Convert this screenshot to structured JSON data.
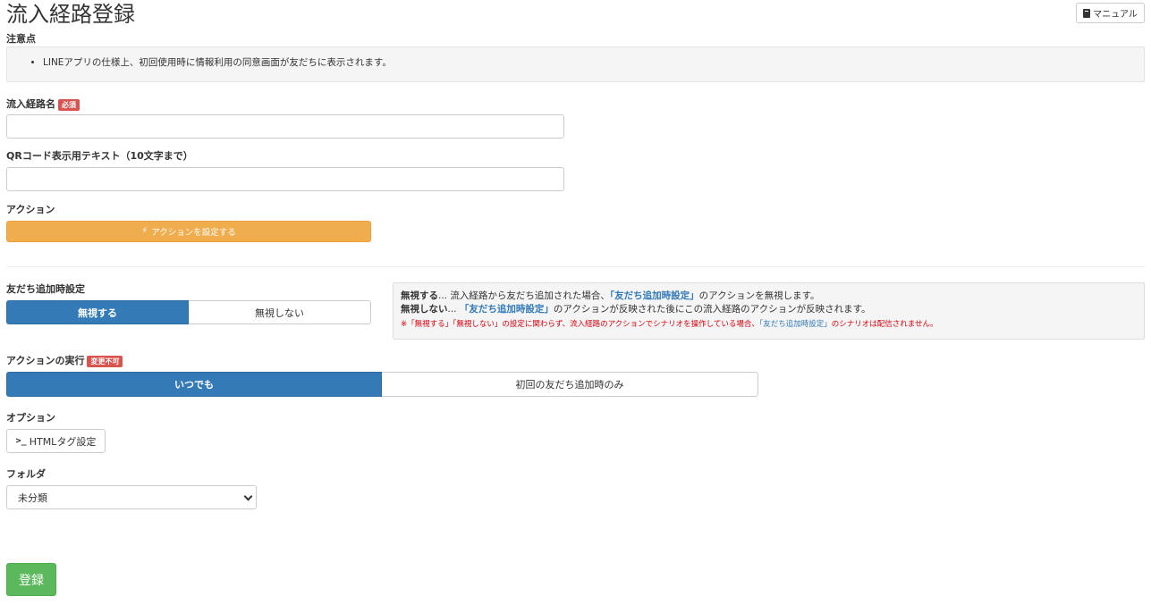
{
  "header": {
    "title": "流入経路登録",
    "manual_label": "マニュアル"
  },
  "notice": {
    "label": "注意点",
    "items": [
      "LINEアプリの仕様上、初回使用時に情報利用の同意画面が友だちに表示されます。"
    ]
  },
  "route_name": {
    "label": "流入経路名",
    "badge": "必須",
    "value": ""
  },
  "qr_text": {
    "label": "QRコード表示用テキスト（10文字まで）",
    "value": ""
  },
  "action": {
    "label": "アクション",
    "button_label": "アクションを設定する"
  },
  "friend_add": {
    "label": "友だち追加時設定",
    "options": [
      "無視する",
      "無視しない"
    ],
    "selected": "無視する",
    "info": {
      "line1_term": "無視する",
      "line1_a": "... 流入経路から友だち追加された場合、",
      "line1_link": "「友だち追加時設定」",
      "line1_b": "のアクションを無視します。",
      "line2_term": "無視しない",
      "line2_a": "... ",
      "line2_link": "「友だち追加時設定」",
      "line2_b": "のアクションが反映された後にこの流入経路のアクションが反映されます。",
      "note_a": "※「無視する」「無視しない」の設定に関わらず、流入経路のアクションでシナリオを操作している場合、",
      "note_link": "「友だち追加時設定」",
      "note_b": "のシナリオは配信されません。"
    }
  },
  "execution": {
    "label": "アクションの実行",
    "badge": "変更不可",
    "options": [
      "いつでも",
      "初回の友だち追加時のみ"
    ],
    "selected": "いつでも"
  },
  "options": {
    "label": "オプション",
    "html_tag_label": "HTMLタグ設定"
  },
  "folder": {
    "label": "フォルダ",
    "selected": "未分類"
  },
  "submit": {
    "label": "登録"
  }
}
